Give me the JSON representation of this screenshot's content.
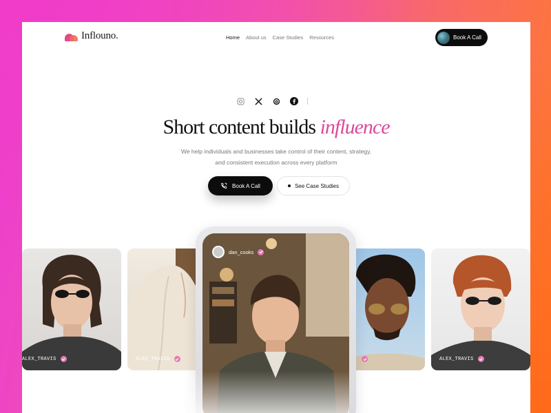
{
  "brand": {
    "name": "Inflouno."
  },
  "nav": {
    "links": [
      "Home",
      "About us",
      "Case Studies",
      "Resources"
    ],
    "active": "Home",
    "cta_label": "Book A Call"
  },
  "socials": [
    "instagram-icon",
    "x-icon",
    "threads-icon",
    "facebook-icon"
  ],
  "hero": {
    "title_main": "Short content builds",
    "title_accent": "influence",
    "subtitle_line1": "We help individuals and businesses take control of their content, strategy,",
    "subtitle_line2": "and consistent execution across every platform",
    "cta_primary": "Book A Call",
    "cta_secondary": "See Case Studies"
  },
  "cards": [
    {
      "username": "ALEX_TRAVIS"
    },
    {
      "username": "ALEX_TRAVIS"
    },
    {
      "username": "dan_cooks"
    },
    {
      "username": ""
    },
    {
      "username": "ALEX_TRAVIS"
    }
  ],
  "colors": {
    "accent": "#d94a9a",
    "button_dark": "#0c0c0c",
    "verify": "#e57ab4"
  }
}
